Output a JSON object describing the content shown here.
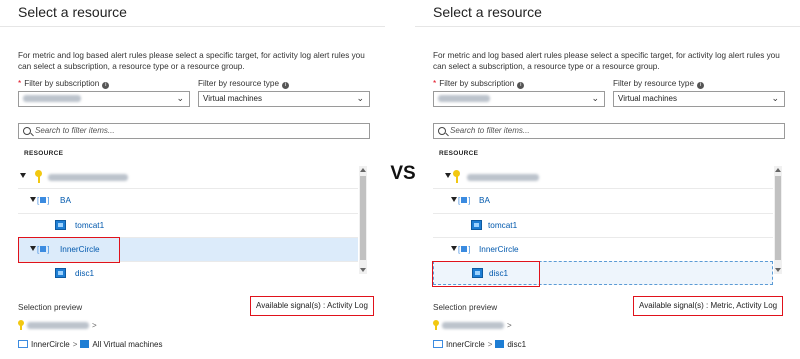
{
  "divider_text": "VS",
  "left": {
    "title": "Select a resource",
    "description": "For metric and log based alert rules please select a specific target, for activity log alert rules you can select a subscription, a resource type or a resource group.",
    "required_mark": "*",
    "subscription_label": "Filter by subscription",
    "resource_type_label": "Filter by resource type",
    "resource_type_value": "Virtual machines",
    "search_placeholder": "Search to filter items...",
    "resource_header": "RESOURCE",
    "tree": {
      "group1": "BA",
      "vm1": "tomcat1",
      "group2": "InnerCircle",
      "vm2": "disc1"
    },
    "selection_preview_label": "Selection preview",
    "signals": "Available signal(s) : Activity Log",
    "path_group": "InnerCircle",
    "path_leaf": "All Virtual machines"
  },
  "right": {
    "title": "Select a resource",
    "description": "For metric and log based alert rules please select a specific target, for activity log alert rules you can select a subscription, a resource type or a resource group.",
    "required_mark": "*",
    "subscription_label": "Filter by subscription",
    "resource_type_label": "Filter by resource type",
    "resource_type_value": "Virtual machines",
    "search_placeholder": "Search to filter items...",
    "resource_header": "RESOURCE",
    "tree": {
      "group1": "BA",
      "vm1": "tomcat1",
      "group2": "InnerCircle",
      "vm2": "disc1"
    },
    "selection_preview_label": "Selection preview",
    "signals": "Available signal(s) : Metric, Activity Log",
    "path_group": "InnerCircle",
    "path_leaf": "disc1"
  },
  "colors": {
    "highlight_red": "#e0121b",
    "link_blue": "#0058ad",
    "selected_row": "#dcebfa"
  },
  "icons": [
    "info-icon",
    "chevron-down-icon",
    "search-icon",
    "key-icon",
    "resource-group-icon",
    "virtual-machine-icon"
  ]
}
